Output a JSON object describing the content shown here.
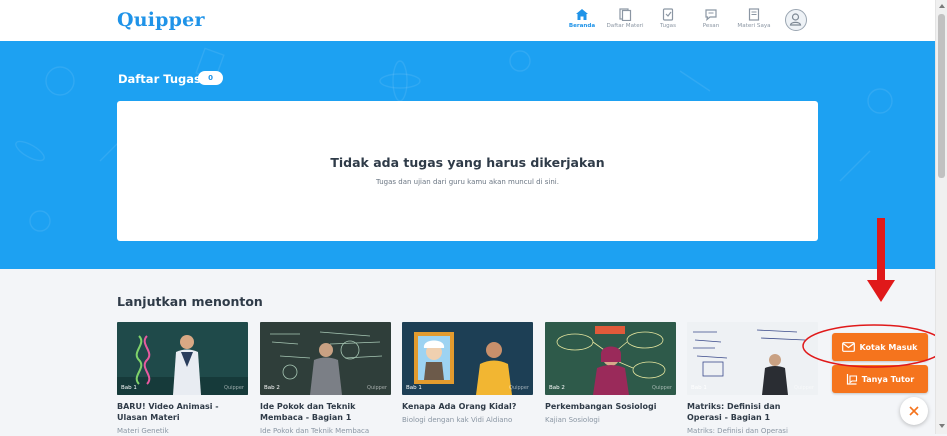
{
  "header": {
    "logo": "Quipper",
    "nav": [
      {
        "label": "Beranda",
        "icon": "home-icon",
        "active": true
      },
      {
        "label": "Daftar Materi",
        "icon": "materials-list-icon",
        "active": false
      },
      {
        "label": "Tugas",
        "icon": "assignment-icon",
        "active": false
      },
      {
        "label": "Pesan",
        "icon": "message-icon",
        "active": false
      },
      {
        "label": "Materi Saya",
        "icon": "my-materials-icon",
        "active": false
      }
    ],
    "avatar_icon": "user-avatar-icon"
  },
  "tasks": {
    "title": "Daftar Tugas",
    "count": "0",
    "empty_title": "Tidak ada tugas yang harus dikerjakan",
    "empty_subtitle": "Tugas dan ujian dari guru kamu akan muncul di sini."
  },
  "continue_watching": {
    "title": "Lanjutkan menonton",
    "videos": [
      {
        "chapter": "Bab 1",
        "title": "BARU! Video Animasi - Ulasan Materi",
        "subtitle": "Materi Genetik"
      },
      {
        "chapter": "Bab 2",
        "title": "Ide Pokok dan Teknik Membaca - Bagian 1",
        "subtitle": "Ide Pokok dan Teknik Membaca"
      },
      {
        "chapter": "Bab 1",
        "title": "Kenapa Ada Orang Kidal?",
        "subtitle": "Biologi dengan kak Vidi Aldiano"
      },
      {
        "chapter": "Bab 2",
        "title": "Perkembangan Sosiologi",
        "subtitle": "Kajian Sosiologi"
      },
      {
        "chapter": "Bab 1",
        "title": "Matriks: Definisi dan Operasi - Bagian 1",
        "subtitle": "Matriks: Definisi dan Operasi"
      }
    ],
    "watermark": "Quipper"
  },
  "actions": {
    "inbox_label": "Kotak Masuk",
    "inbox_icon": "envelope-icon",
    "tutor_label": "Tanya Tutor",
    "tutor_icon": "chat-question-icon",
    "close_icon": "close-icon"
  },
  "colors": {
    "brand": "#1f93e8",
    "hero": "#1da1f2",
    "action": "#f5741d",
    "annotation": "#e0191a"
  }
}
